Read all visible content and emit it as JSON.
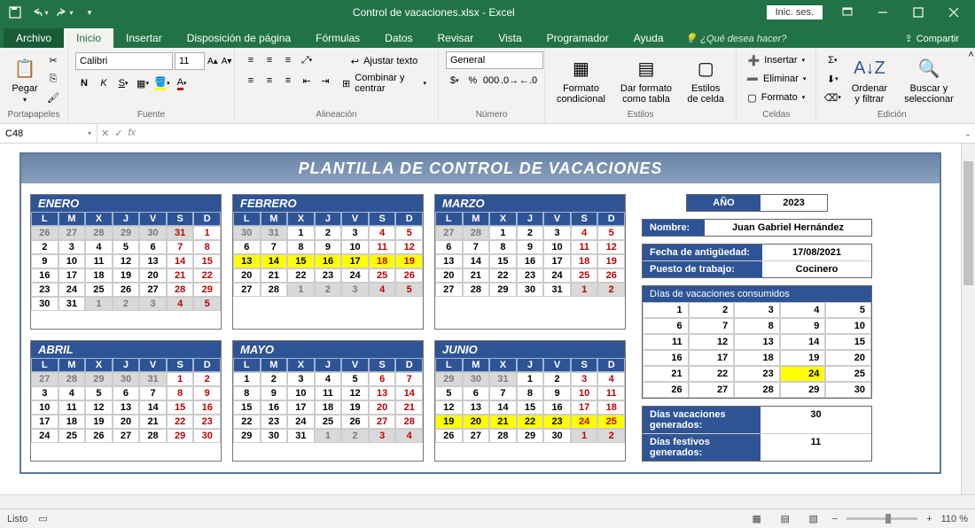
{
  "titlebar": {
    "filename": "Control de vacaciones.xlsx  -  Excel",
    "signin": "Inic. ses."
  },
  "tabs": {
    "archivo": "Archivo",
    "inicio": "Inicio",
    "insertar": "Insertar",
    "disposicion": "Disposición de página",
    "formulas": "Fórmulas",
    "datos": "Datos",
    "revisar": "Revisar",
    "vista": "Vista",
    "programador": "Programador",
    "ayuda": "Ayuda",
    "tellme": "¿Qué desea hacer?",
    "share": "Compartir"
  },
  "ribbon": {
    "portapapeles": {
      "pegar": "Pegar",
      "label": "Portapapeles"
    },
    "fuente": {
      "label": "Fuente",
      "font": "Calibri",
      "size": "11"
    },
    "alineacion": {
      "label": "Alineación",
      "ajustar": "Ajustar texto",
      "combinar": "Combinar y centrar"
    },
    "numero": {
      "label": "Número",
      "format": "General"
    },
    "estilos": {
      "label": "Estilos",
      "cond": "Formato condicional",
      "tabla": "Dar formato como tabla",
      "celda": "Estilos de celda"
    },
    "celdas": {
      "label": "Celdas",
      "insertar": "Insertar",
      "eliminar": "Eliminar",
      "formato": "Formato"
    },
    "edicion": {
      "label": "Edición",
      "ordenar": "Ordenar y filtrar",
      "buscar": "Buscar y seleccionar"
    }
  },
  "formula_bar": {
    "cell": "C48"
  },
  "doc": {
    "title": "PLANTILLA DE CONTROL DE VACACIONES",
    "anio_label": "AÑO",
    "anio": "2023",
    "nombre_label": "Nombre:",
    "nombre": "Juan Gabriel Hernández",
    "antig_label": "Fecha de antigüedad:",
    "antig": "17/08/2021",
    "puesto_label": "Puesto de trabajo:",
    "puesto": "Cocinero",
    "consum_label": "Días de vacaciones consumidos",
    "gen_label": "Días vacaciones generados:",
    "gen": "30",
    "fest_label": "Días festivos generados:",
    "fest": "11"
  },
  "consume_highlight": 24,
  "months": [
    {
      "name": "ENERO",
      "lead": [
        26,
        27,
        28,
        29,
        30,
        31
      ],
      "days": 31,
      "yellow": [],
      "trail": [
        1,
        2,
        3,
        4,
        5
      ]
    },
    {
      "name": "FEBRERO",
      "lead": [
        30,
        31
      ],
      "days": 28,
      "yellow": [
        13,
        14,
        15,
        16,
        17,
        18,
        19
      ],
      "trail": [
        1,
        2,
        3,
        4,
        5
      ]
    },
    {
      "name": "MARZO",
      "lead": [
        27,
        28
      ],
      "days": 31,
      "yellow": [],
      "trail": [
        1,
        2
      ]
    },
    {
      "name": "ABRIL",
      "lead": [
        27,
        28,
        29,
        30,
        31
      ],
      "days": 30,
      "yellow": [],
      "trail": []
    },
    {
      "name": "MAYO",
      "lead": [],
      "days": 31,
      "yellow": [],
      "trail": [
        1,
        2,
        3,
        4
      ]
    },
    {
      "name": "JUNIO",
      "lead": [
        29,
        30,
        31
      ],
      "days": 30,
      "yellow": [
        19,
        20,
        21,
        22,
        23,
        24,
        25
      ],
      "trail": [
        1,
        2
      ]
    }
  ],
  "dow": [
    "L",
    "M",
    "X",
    "J",
    "V",
    "S",
    "D"
  ],
  "status": {
    "listo": "Listo",
    "zoom": "110 %"
  }
}
